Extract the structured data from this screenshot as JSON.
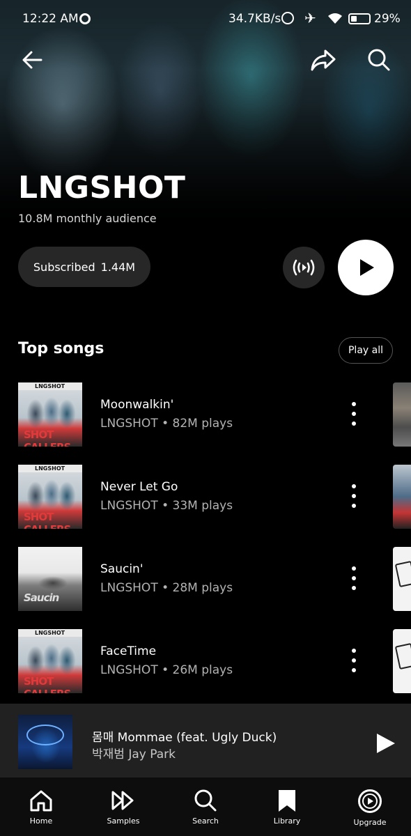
{
  "status_bar": {
    "time": "12:22 AM",
    "net_speed": "34.7KB/s",
    "battery": "29%"
  },
  "artist": {
    "name": "LNGSHOT",
    "audience": "10.8M monthly audience",
    "subscribe_label": "Subscribed",
    "subscriber_count": "1.44M"
  },
  "top_songs": {
    "title": "Top songs",
    "play_all_label": "Play all",
    "items": [
      {
        "title": "Moonwalkin'",
        "meta": "LNGSHOT • 82M plays",
        "art_tag": "LNGSHOT",
        "art_text": "SHOT CALLERS"
      },
      {
        "title": "Never Let Go",
        "meta": "LNGSHOT • 33M plays",
        "art_tag": "LNGSHOT",
        "art_text": "SHOT CALLERS"
      },
      {
        "title": "Saucin'",
        "meta": "LNGSHOT • 28M plays",
        "art_tag": "",
        "art_text": "Saucin"
      },
      {
        "title": "FaceTime",
        "meta": "LNGSHOT • 26M plays",
        "art_tag": "LNGSHOT",
        "art_text": "SHOT CALLERS"
      }
    ]
  },
  "now_playing": {
    "title": "몸매 Mommae (feat. Ugly Duck)",
    "artist": "박재범 Jay Park"
  },
  "bottom_nav": [
    {
      "label": "Home",
      "icon": "home-icon"
    },
    {
      "label": "Samples",
      "icon": "samples-icon"
    },
    {
      "label": "Search",
      "icon": "search-icon"
    },
    {
      "label": "Library",
      "icon": "library-icon"
    },
    {
      "label": "Upgrade",
      "icon": "upgrade-icon"
    }
  ]
}
